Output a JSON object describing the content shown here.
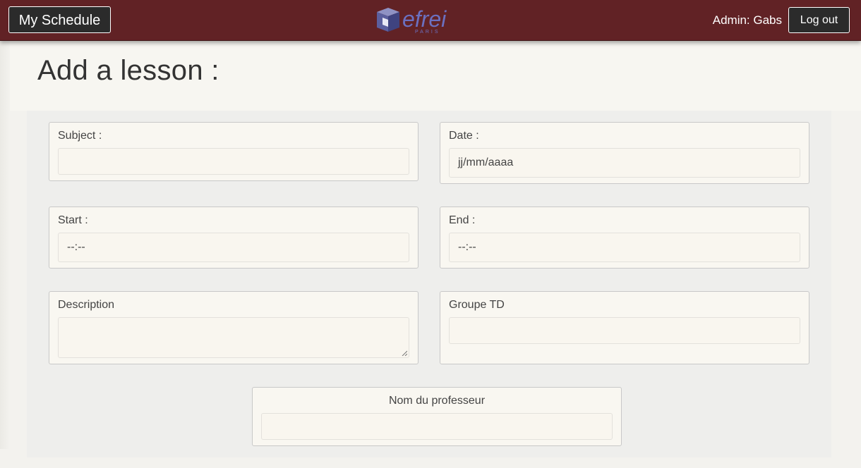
{
  "navbar": {
    "brand_label": "My Schedule",
    "logo_text": "efrei",
    "logo_subtext": "PARIS",
    "admin_label": "Admin: Gabs",
    "logout_label": "Log out",
    "bg_color": "#612225"
  },
  "page": {
    "title": "Add a lesson :"
  },
  "form": {
    "subject": {
      "label": "Subject :",
      "value": ""
    },
    "date": {
      "label": "Date :",
      "placeholder": "jj/mm/aaaa"
    },
    "start": {
      "label": "Start :",
      "placeholder": "--:--"
    },
    "end": {
      "label": "End :",
      "placeholder": "--:--"
    },
    "description": {
      "label": "Description",
      "value": ""
    },
    "groupe_td": {
      "label": "Groupe TD",
      "value": ""
    },
    "professeur": {
      "label": "Nom du professeur",
      "value": ""
    }
  }
}
